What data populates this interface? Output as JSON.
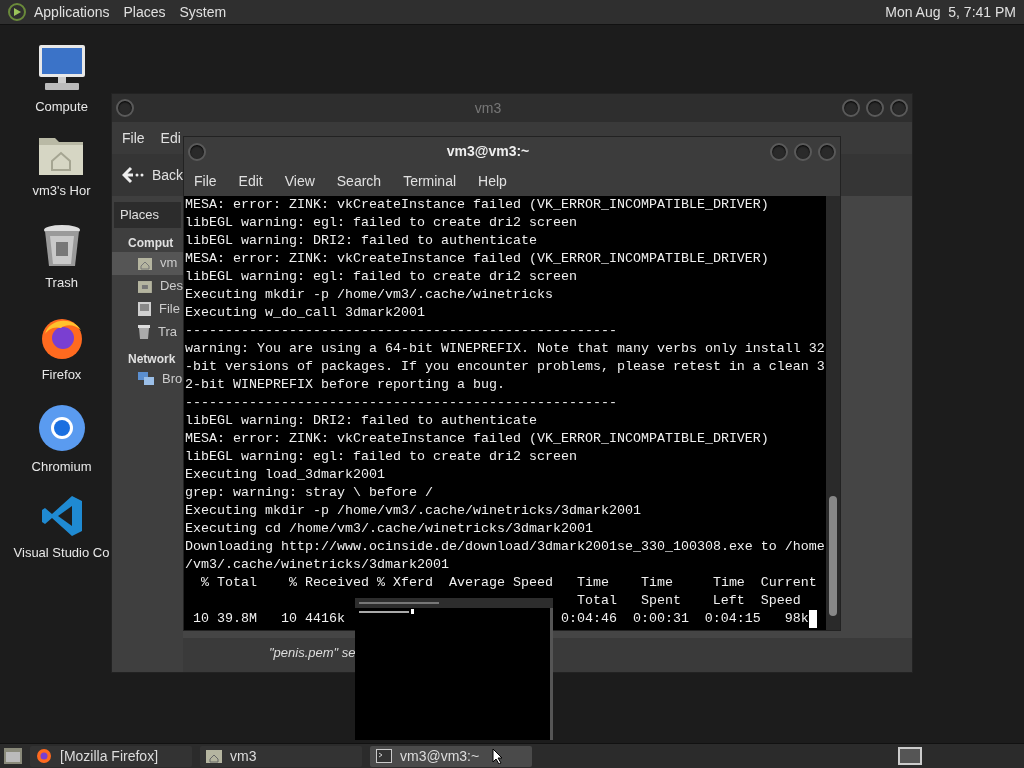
{
  "top_panel": {
    "menus": [
      "Applications",
      "Places",
      "System"
    ],
    "clock": "Mon Aug  5, 7:41 PM"
  },
  "desktop_icons": [
    {
      "label": "Compute",
      "kind": "computer"
    },
    {
      "label": "vm3's Hor",
      "kind": "home"
    },
    {
      "label": "Trash",
      "kind": "trash"
    },
    {
      "label": "Firefox",
      "kind": "firefox"
    },
    {
      "label": "Chromium",
      "kind": "chromium"
    },
    {
      "label": "Visual Studio Co",
      "kind": "vscode"
    }
  ],
  "file_manager": {
    "title": "vm3",
    "menus": [
      "File",
      "Edi"
    ],
    "back": "Back",
    "sidebar_header": "Places",
    "sections": [
      {
        "title": "Comput",
        "items": [
          {
            "label": "vm",
            "kind": "home",
            "selected": true
          },
          {
            "label": "Des",
            "kind": "desktop",
            "selected": false
          },
          {
            "label": "File",
            "kind": "drive",
            "selected": false
          },
          {
            "label": "Tra",
            "kind": "trash",
            "selected": false
          }
        ]
      },
      {
        "title": "Network",
        "items": [
          {
            "label": "Bro",
            "kind": "network",
            "selected": false
          }
        ]
      }
    ],
    "status": "\"penis.pem\" se"
  },
  "terminal": {
    "title": "vm3@vm3:~",
    "menus": [
      "File",
      "Edit",
      "View",
      "Search",
      "Terminal",
      "Help"
    ],
    "lines": [
      "MESA: error: ZINK: vkCreateInstance failed (VK_ERROR_INCOMPATIBLE_DRIVER)",
      "libEGL warning: egl: failed to create dri2 screen",
      "libEGL warning: DRI2: failed to authenticate",
      "MESA: error: ZINK: vkCreateInstance failed (VK_ERROR_INCOMPATIBLE_DRIVER)",
      "libEGL warning: egl: failed to create dri2 screen",
      "Executing mkdir -p /home/vm3/.cache/winetricks",
      "Executing w_do_call 3dmark2001",
      "------------------------------------------------------",
      "warning: You are using a 64-bit WINEPREFIX. Note that many verbs only install 32",
      "-bit versions of packages. If you encounter problems, please retest in a clean 3",
      "2-bit WINEPREFIX before reporting a bug.",
      "------------------------------------------------------",
      "libEGL warning: DRI2: failed to authenticate",
      "MESA: error: ZINK: vkCreateInstance failed (VK_ERROR_INCOMPATIBLE_DRIVER)",
      "libEGL warning: egl: failed to create dri2 screen",
      "Executing load_3dmark2001",
      "grep: warning: stray \\ before /",
      "Executing mkdir -p /home/vm3/.cache/winetricks/3dmark2001",
      "Executing cd /home/vm3/.cache/winetricks/3dmark2001",
      "Downloading http://www.ocinside.de/download/3dmark2001se_330_100308.exe to /home",
      "/vm3/.cache/winetricks/3dmark2001",
      "  % Total    % Received % Xferd  Average Speed   Time    Time     Time  Current"
    ],
    "partial_lines": [
      {
        "right": "  Total   Spent    Left  Speed"
      },
      {
        "left": " 10 39.8M   10 4416k",
        "right": "0:04:46  0:00:31  0:04:15   98k"
      }
    ]
  },
  "taskbar": {
    "tasks": [
      {
        "label": "[Mozilla Firefox]",
        "kind": "firefox",
        "selected": false
      },
      {
        "label": "vm3",
        "kind": "folder",
        "selected": false
      },
      {
        "label": "vm3@vm3:~",
        "kind": "terminal",
        "selected": true
      }
    ]
  }
}
